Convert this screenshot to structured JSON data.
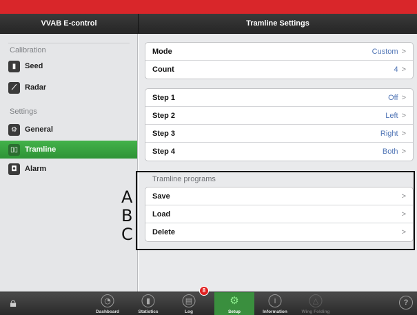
{
  "header": {
    "left_title": "VVAB E-control",
    "right_title": "Tramline Settings"
  },
  "sidebar": {
    "calibration_label": "Calibration",
    "settings_label": "Settings",
    "items": [
      {
        "label": "Seed",
        "icon": "seed-bag-icon",
        "glyph": "▮"
      },
      {
        "label": "Radar",
        "icon": "radar-icon",
        "glyph": "⟋"
      },
      {
        "label": "General",
        "icon": "general-settings-icon",
        "glyph": "⚙"
      },
      {
        "label": "Tramline",
        "icon": "tramline-icon",
        "glyph": "▯▯",
        "active": true
      },
      {
        "label": "Alarm",
        "icon": "alarm-icon",
        "glyph": "◘"
      }
    ]
  },
  "main": {
    "mode": {
      "label": "Mode",
      "value": "Custom"
    },
    "count": {
      "label": "Count",
      "value": "4"
    },
    "steps": [
      {
        "label": "Step 1",
        "value": "Off"
      },
      {
        "label": "Step 2",
        "value": "Left"
      },
      {
        "label": "Step 3",
        "value": "Right"
      },
      {
        "label": "Step 4",
        "value": "Both"
      }
    ],
    "programs_title": "Tramline programs",
    "programs": [
      {
        "label": "Save"
      },
      {
        "label": "Load"
      },
      {
        "label": "Delete"
      }
    ],
    "chevron": ">"
  },
  "annotations": {
    "a": "A",
    "b": "B",
    "c": "C"
  },
  "tabbar": {
    "tabs": [
      {
        "label": "Dashboard",
        "icon": "speedometer-icon",
        "glyph": "◔"
      },
      {
        "label": "Statistics",
        "icon": "statistics-icon",
        "glyph": "▮"
      },
      {
        "label": "Log",
        "icon": "log-icon",
        "glyph": "▤",
        "badge": "8"
      },
      {
        "label": "Setup",
        "icon": "gears-icon",
        "glyph": "⚙",
        "active": true
      },
      {
        "label": "Information",
        "icon": "info-icon",
        "glyph": "i"
      },
      {
        "label": "Wing Folding",
        "icon": "wing-folding-icon",
        "glyph": "△",
        "disabled": true
      }
    ],
    "help_glyph": "?"
  },
  "colors": {
    "accent_red": "#d9262a",
    "active_green": "#3a9b40",
    "value_blue": "#4f74b5"
  }
}
